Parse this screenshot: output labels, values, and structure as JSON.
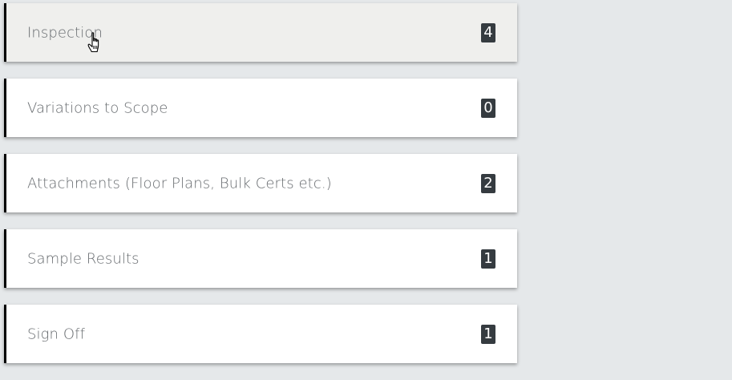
{
  "panels": [
    {
      "label": "Inspection",
      "count": "4"
    },
    {
      "label": "Variations to Scope",
      "count": "0"
    },
    {
      "label": "Attachments (Floor Plans, Bulk Certs etc.)",
      "count": "2"
    },
    {
      "label": "Sample Results",
      "count": "1"
    },
    {
      "label": "Sign Off",
      "count": "1"
    }
  ],
  "colors": {
    "page_background": "#e5e8ea",
    "panel_background": "#ffffff",
    "panel_hover_background": "#efefed",
    "accent_border": "#000000",
    "badge_background": "#353b40",
    "label_text": "#666a6e"
  },
  "cursor": {
    "icon": "hand-pointer-icon"
  }
}
